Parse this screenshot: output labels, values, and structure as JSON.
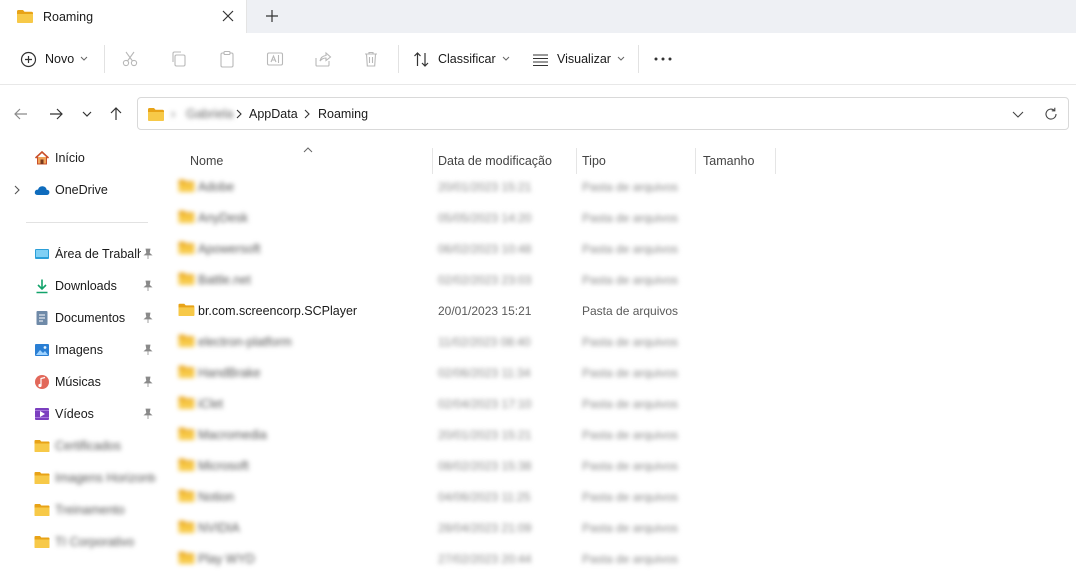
{
  "tab": {
    "title": "Roaming"
  },
  "commands": {
    "new": "Novo",
    "sort": "Classificar",
    "view": "Visualizar"
  },
  "address": {
    "crumbs": [
      "Gabriela",
      "AppData",
      "Roaming"
    ]
  },
  "sidebar": {
    "top": [
      {
        "label": "Início",
        "icon": "home-icon"
      },
      {
        "label": "OneDrive",
        "icon": "cloud-icon"
      }
    ],
    "quick": [
      {
        "label": "Área de Trabalho",
        "icon": "desktop-icon"
      },
      {
        "label": "Downloads",
        "icon": "download-icon"
      },
      {
        "label": "Documentos",
        "icon": "document-icon"
      },
      {
        "label": "Imagens",
        "icon": "image-icon"
      },
      {
        "label": "Músicas",
        "icon": "music-icon"
      },
      {
        "label": "Vídeos",
        "icon": "video-icon"
      }
    ],
    "folders": [
      {
        "label": "Certificados"
      },
      {
        "label": "Imagens Horizonte"
      },
      {
        "label": "Treinamento"
      },
      {
        "label": "TI Corporativo"
      }
    ]
  },
  "columns": {
    "name": "Nome",
    "date": "Data de modificação",
    "type": "Tipo",
    "size": "Tamanho"
  },
  "files": [
    {
      "name": "Adobe",
      "date": "20/01/2023 15:21",
      "type": "Pasta de arquivos",
      "blurred": true
    },
    {
      "name": "AnyDesk",
      "date": "05/05/2023 14:20",
      "type": "Pasta de arquivos",
      "blurred": true
    },
    {
      "name": "Apowersoft",
      "date": "06/02/2023 10:48",
      "type": "Pasta de arquivos",
      "blurred": true
    },
    {
      "name": "Battle.net",
      "date": "02/02/2023 23:03",
      "type": "Pasta de arquivos",
      "blurred": true
    },
    {
      "name": "br.com.screencorp.SCPlayer",
      "date": "20/01/2023 15:21",
      "type": "Pasta de arquivos",
      "blurred": false
    },
    {
      "name": "electron-platform",
      "date": "11/02/2023 08:40",
      "type": "Pasta de arquivos",
      "blurred": true
    },
    {
      "name": "HandBrake",
      "date": "02/06/2023 11:34",
      "type": "Pasta de arquivos",
      "blurred": true
    },
    {
      "name": "iClet",
      "date": "02/04/2023 17:10",
      "type": "Pasta de arquivos",
      "blurred": true
    },
    {
      "name": "Macromedia",
      "date": "20/01/2023 15:21",
      "type": "Pasta de arquivos",
      "blurred": true
    },
    {
      "name": "Microsoft",
      "date": "08/02/2023 15:38",
      "type": "Pasta de arquivos",
      "blurred": true
    },
    {
      "name": "Notion",
      "date": "04/06/2023 11:25",
      "type": "Pasta de arquivos",
      "blurred": true
    },
    {
      "name": "NVIDIA",
      "date": "28/04/2023 21:09",
      "type": "Pasta de arquivos",
      "blurred": true
    },
    {
      "name": "Play WYD",
      "date": "27/02/2023 20:44",
      "type": "Pasta de arquivos",
      "blurred": true
    }
  ],
  "colors": {
    "folder": "#f5c342",
    "folderDark": "#e8a317",
    "accent": "#0067c0"
  }
}
